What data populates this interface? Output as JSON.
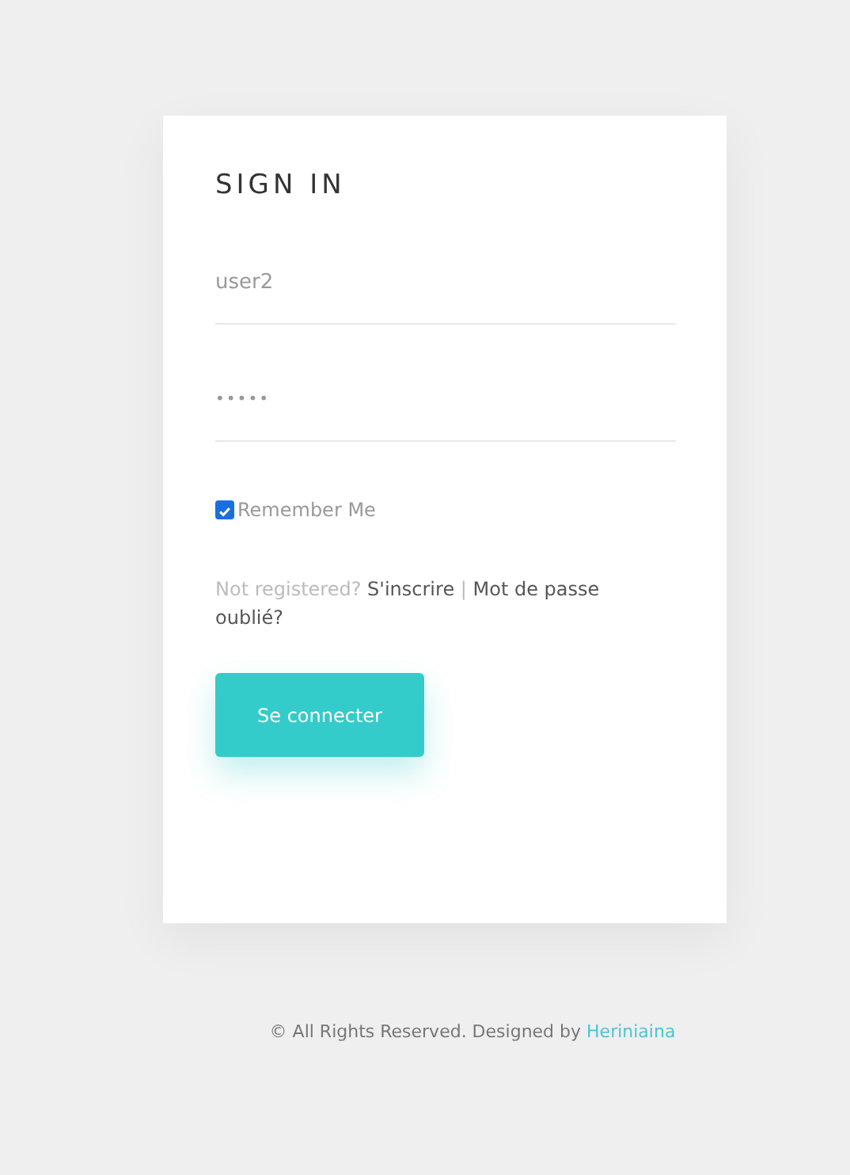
{
  "form": {
    "title": "SIGN IN",
    "fields": [
      {
        "kind": "text",
        "value": "user2"
      },
      {
        "kind": "password",
        "value": "•••••"
      }
    ],
    "remember": {
      "label": "Remember Me",
      "checked": true
    },
    "register_note": {
      "prefix": "Not registered?",
      "links": [
        "S'inscrire",
        "Mot de passe oublié?"
      ],
      "separator": "|"
    },
    "submit": "Se connecter"
  },
  "footer": {
    "text": "© All Rights Reserved. Designed by",
    "link": "Heriniaina"
  }
}
